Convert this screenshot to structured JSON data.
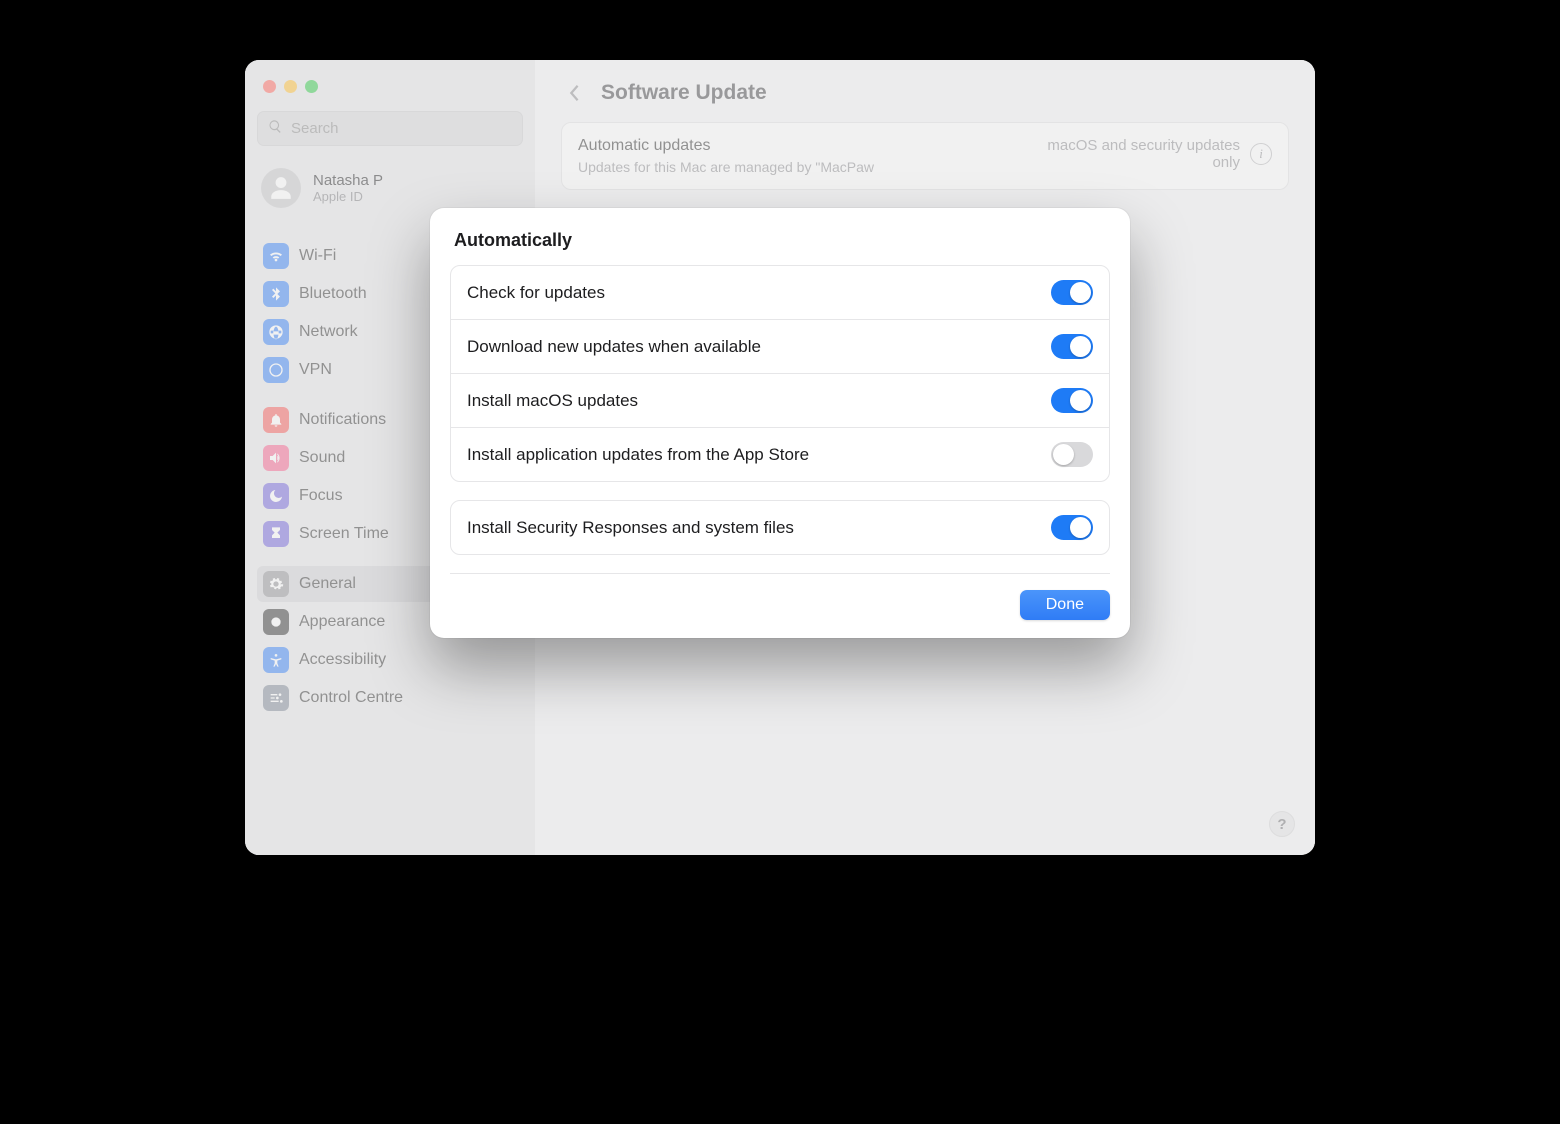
{
  "search": {
    "placeholder": "Search"
  },
  "user": {
    "name": "Natasha P",
    "sub": "Apple ID"
  },
  "sidebar": {
    "items": [
      {
        "label": "Wi-Fi"
      },
      {
        "label": "Bluetooth"
      },
      {
        "label": "Network"
      },
      {
        "label": "VPN"
      },
      {
        "label": "Notifications"
      },
      {
        "label": "Sound"
      },
      {
        "label": "Focus"
      },
      {
        "label": "Screen Time"
      },
      {
        "label": "General"
      },
      {
        "label": "Appearance"
      },
      {
        "label": "Accessibility"
      },
      {
        "label": "Control Centre"
      }
    ]
  },
  "header": {
    "title": "Software Update"
  },
  "card": {
    "title": "Automatic updates",
    "sub": "Updates for this Mac are managed by \"MacPaw",
    "status": "macOS and security updates only"
  },
  "modal": {
    "title": "Automatically",
    "rows": [
      {
        "label": "Check for updates",
        "on": true
      },
      {
        "label": "Download new updates when available",
        "on": true
      },
      {
        "label": "Install macOS updates",
        "on": true
      },
      {
        "label": "Install application updates from the App Store",
        "on": false
      }
    ],
    "rows2": [
      {
        "label": "Install Security Responses and system files",
        "on": true
      }
    ],
    "done": "Done"
  }
}
